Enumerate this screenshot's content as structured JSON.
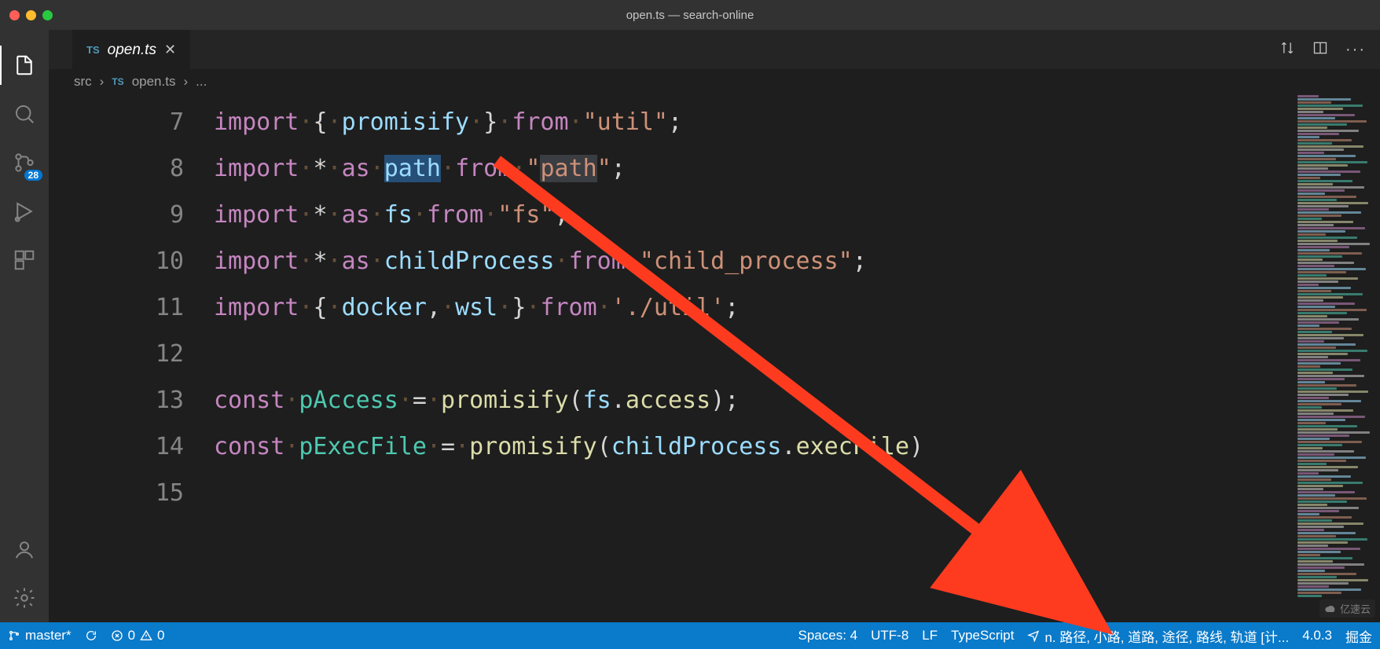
{
  "window": {
    "title": "open.ts — search-online"
  },
  "activity": {
    "scm_badge": "28"
  },
  "tab": {
    "icon_label": "TS",
    "filename": "open.ts"
  },
  "breadcrumb": {
    "seg1": "src",
    "icon_label": "TS",
    "seg2": "open.ts",
    "seg3": "..."
  },
  "code_lines": [
    {
      "n": "7",
      "tokens": [
        [
          "kw",
          "import"
        ],
        [
          "wh",
          "·"
        ],
        [
          "op",
          "{"
        ],
        [
          "wh",
          "·"
        ],
        [
          "id",
          "promisify"
        ],
        [
          "wh",
          "·"
        ],
        [
          "op",
          "}"
        ],
        [
          "wh",
          "·"
        ],
        [
          "kw",
          "from"
        ],
        [
          "wh",
          "·"
        ],
        [
          "str",
          "\"util\""
        ],
        [
          "op",
          ";"
        ]
      ]
    },
    {
      "n": "8",
      "tokens": [
        [
          "kw",
          "import"
        ],
        [
          "wh",
          "·"
        ],
        [
          "op",
          "*"
        ],
        [
          "wh",
          "·"
        ],
        [
          "kw",
          "as"
        ],
        [
          "wh",
          "·"
        ],
        [
          "id sel",
          "path"
        ],
        [
          "wh",
          "·"
        ],
        [
          "kw",
          "from"
        ],
        [
          "wh",
          "·"
        ],
        [
          "str",
          "\""
        ],
        [
          "str dimbox",
          "path"
        ],
        [
          "str",
          "\""
        ],
        [
          "op",
          ";"
        ]
      ]
    },
    {
      "n": "9",
      "tokens": [
        [
          "kw",
          "import"
        ],
        [
          "wh",
          "·"
        ],
        [
          "op",
          "*"
        ],
        [
          "wh",
          "·"
        ],
        [
          "kw",
          "as"
        ],
        [
          "wh",
          "·"
        ],
        [
          "id",
          "fs"
        ],
        [
          "wh",
          "·"
        ],
        [
          "kw",
          "from"
        ],
        [
          "wh",
          "·"
        ],
        [
          "str",
          "\"fs\""
        ],
        [
          "op",
          ";"
        ]
      ]
    },
    {
      "n": "10",
      "tokens": [
        [
          "kw",
          "import"
        ],
        [
          "wh",
          "·"
        ],
        [
          "op",
          "*"
        ],
        [
          "wh",
          "·"
        ],
        [
          "kw",
          "as"
        ],
        [
          "wh",
          "·"
        ],
        [
          "id",
          "childProcess"
        ],
        [
          "wh",
          "·"
        ],
        [
          "kw",
          "from"
        ],
        [
          "wh",
          "·"
        ],
        [
          "str",
          "\"child_process\""
        ],
        [
          "op",
          ";"
        ]
      ]
    },
    {
      "n": "11",
      "tokens": [
        [
          "kw",
          "import"
        ],
        [
          "wh",
          "·"
        ],
        [
          "op",
          "{"
        ],
        [
          "wh",
          "·"
        ],
        [
          "id",
          "docker"
        ],
        [
          "op",
          ","
        ],
        [
          "wh",
          "·"
        ],
        [
          "id",
          "wsl"
        ],
        [
          "wh",
          "·"
        ],
        [
          "op",
          "}"
        ],
        [
          "wh",
          "·"
        ],
        [
          "kw",
          "from"
        ],
        [
          "wh",
          "·"
        ],
        [
          "str",
          "'./util'"
        ],
        [
          "op",
          ";"
        ]
      ]
    },
    {
      "n": "12",
      "tokens": []
    },
    {
      "n": "13",
      "tokens": [
        [
          "kw",
          "const"
        ],
        [
          "wh",
          "·"
        ],
        [
          "ty",
          "pAccess"
        ],
        [
          "wh",
          "·"
        ],
        [
          "op",
          "="
        ],
        [
          "wh",
          "·"
        ],
        [
          "fn",
          "promisify"
        ],
        [
          "op",
          "("
        ],
        [
          "id",
          "fs"
        ],
        [
          "op",
          "."
        ],
        [
          "fn",
          "access"
        ],
        [
          "op",
          ")"
        ],
        [
          "op",
          ";"
        ]
      ]
    },
    {
      "n": "14",
      "tokens": [
        [
          "kw",
          "const"
        ],
        [
          "wh",
          "·"
        ],
        [
          "ty",
          "pExecFile"
        ],
        [
          "wh",
          "·"
        ],
        [
          "op",
          "="
        ],
        [
          "wh",
          "·"
        ],
        [
          "fn",
          "promisify"
        ],
        [
          "op",
          "("
        ],
        [
          "id",
          "childProcess"
        ],
        [
          "op",
          "."
        ],
        [
          "fn",
          "execFile"
        ],
        [
          "op",
          ")"
        ]
      ]
    },
    {
      "n": "15",
      "tokens": []
    }
  ],
  "status": {
    "branch": "master*",
    "errors": "0",
    "warnings": "0",
    "spaces": "Spaces: 4",
    "encoding": "UTF-8",
    "eol": "LF",
    "language": "TypeScript",
    "translation": "n. 路径, 小路, 道路, 途径, 路线, 轨道 [计...",
    "version": "4.0.3",
    "extra": "掘金"
  },
  "watermark": {
    "text": "亿速云"
  }
}
